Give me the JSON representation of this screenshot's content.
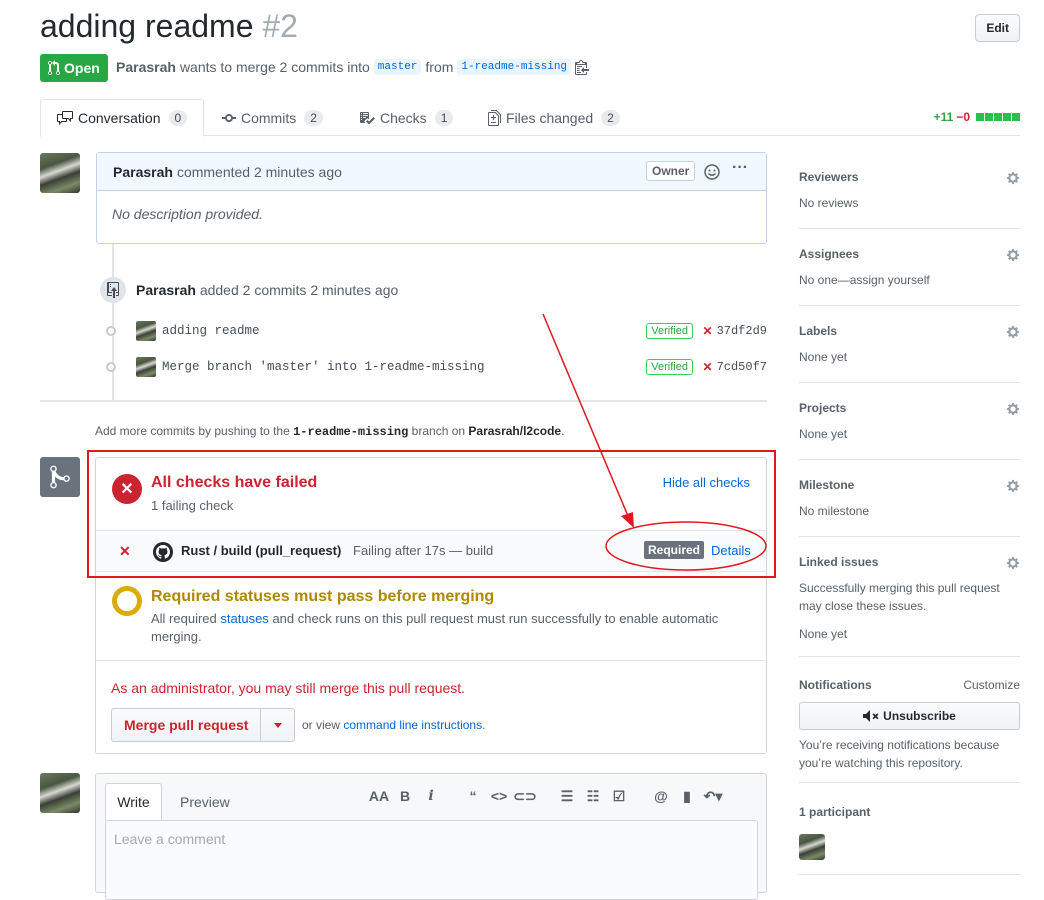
{
  "header": {
    "title": "adding readme",
    "number": "#2",
    "edit_label": "Edit",
    "state": "Open",
    "author": "Parasrah",
    "merge_text": "wants to merge 2 commits into",
    "base_branch": "master",
    "from_text": "from",
    "head_branch": "1-readme-missing"
  },
  "tabs": [
    {
      "label": "Conversation",
      "count": "0"
    },
    {
      "label": "Commits",
      "count": "2"
    },
    {
      "label": "Checks",
      "count": "1"
    },
    {
      "label": "Files changed",
      "count": "2"
    }
  ],
  "diffstat": {
    "additions": "+11",
    "deletions": "−0"
  },
  "comment": {
    "author": "Parasrah",
    "action": "commented 2 minutes ago",
    "badge": "Owner",
    "body": "No description provided."
  },
  "commits_event": {
    "author": "Parasrah",
    "action": "added 2 commits 2 minutes ago",
    "commits": [
      {
        "message": "adding readme",
        "verified": "Verified",
        "sha": "37df2d9"
      },
      {
        "message": "Merge branch 'master' into 1-readme-missing",
        "verified": "Verified",
        "sha": "7cd50f7"
      }
    ]
  },
  "hint": {
    "prefix": "Add more commits by pushing to the",
    "branch": "1-readme-missing",
    "middle": "branch on",
    "repo": "Parasrah/l2code",
    "suffix": "."
  },
  "checks": {
    "title": "All checks have failed",
    "subtitle": "1 failing check",
    "hide_link": "Hide all checks",
    "row": {
      "name": "Rust / build (pull_request)",
      "description": "Failing after 17s — build",
      "required": "Required",
      "details": "Details"
    }
  },
  "status": {
    "title": "Required statuses must pass before merging",
    "desc_prefix": "All required",
    "desc_link": "statuses",
    "desc_suffix": "and check runs on this pull request must run successfully to enable automatic merging."
  },
  "admin": {
    "note": "As an administrator, you may still merge this pull request.",
    "merge_button": "Merge pull request",
    "or_view": "or view",
    "cli_link": "command line instructions",
    "cli_suffix": "."
  },
  "editor": {
    "write_tab": "Write",
    "preview_tab": "Preview",
    "placeholder": "Leave a comment"
  },
  "sidebar": {
    "reviewers": {
      "label": "Reviewers",
      "value": "No reviews"
    },
    "assignees": {
      "label": "Assignees",
      "value": "No one—assign yourself"
    },
    "labels": {
      "label": "Labels",
      "value": "None yet"
    },
    "projects": {
      "label": "Projects",
      "value": "None yet"
    },
    "milestone": {
      "label": "Milestone",
      "value": "No milestone"
    },
    "linked_issues": {
      "label": "Linked issues",
      "desc_line1": "Successfully merging this pull request",
      "desc_line2": "may close these issues.",
      "value": "None yet"
    },
    "notifications": {
      "label": "Notifications",
      "customize": "Customize",
      "button": "Unsubscribe",
      "desc_line1": "You’re receiving notifications because",
      "desc_line2": "you’re watching this repository."
    },
    "participants": {
      "label": "1 participant"
    }
  },
  "colors": {
    "accent": "#0366d6",
    "success": "#28a745",
    "danger": "#cb2431",
    "warning": "#dbab09",
    "annotation": "#e2181f"
  }
}
